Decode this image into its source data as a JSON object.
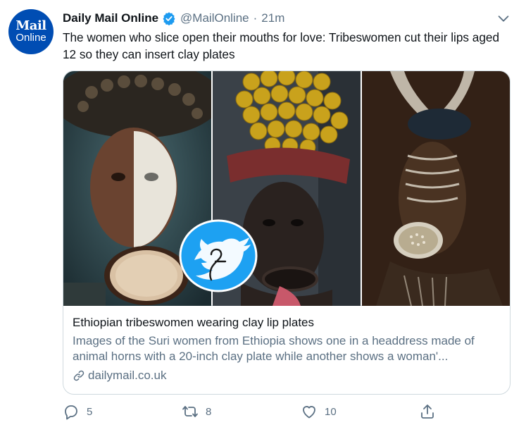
{
  "author": {
    "avatar_line1": "Mail",
    "avatar_line2": "Online",
    "display_name": "Daily Mail Online",
    "handle": "@MailOnline",
    "separator": "·",
    "time": "21m",
    "verified": true
  },
  "tweet": {
    "text": "The women who slice open their mouths for love: Tribeswomen cut their lips aged 12 so they can insert clay plates"
  },
  "card": {
    "title": "Ethiopian tribeswomen wearing clay lip plates",
    "description": "Images of the Suri women from Ethiopia shows one in a headdress made of animal horns with a 20-inch clay plate while another shows a woman'...",
    "domain": "dailymail.co.uk",
    "images": [
      "suri-woman-white-face-paint",
      "woman-with-fruit-headdress",
      "woman-with-horn-headdress"
    ]
  },
  "actions": {
    "replies": "5",
    "retweets": "8",
    "likes": "10"
  },
  "colors": {
    "accent": "#1d9bf0",
    "secondary_text": "#5b7083",
    "border": "#cfd9de",
    "avatar_bg": "#004db3"
  },
  "icons": [
    "verified-badge-icon",
    "chevron-down-icon",
    "link-icon",
    "reply-icon",
    "retweet-icon",
    "like-icon",
    "share-icon",
    "bird-watermark-icon"
  ]
}
